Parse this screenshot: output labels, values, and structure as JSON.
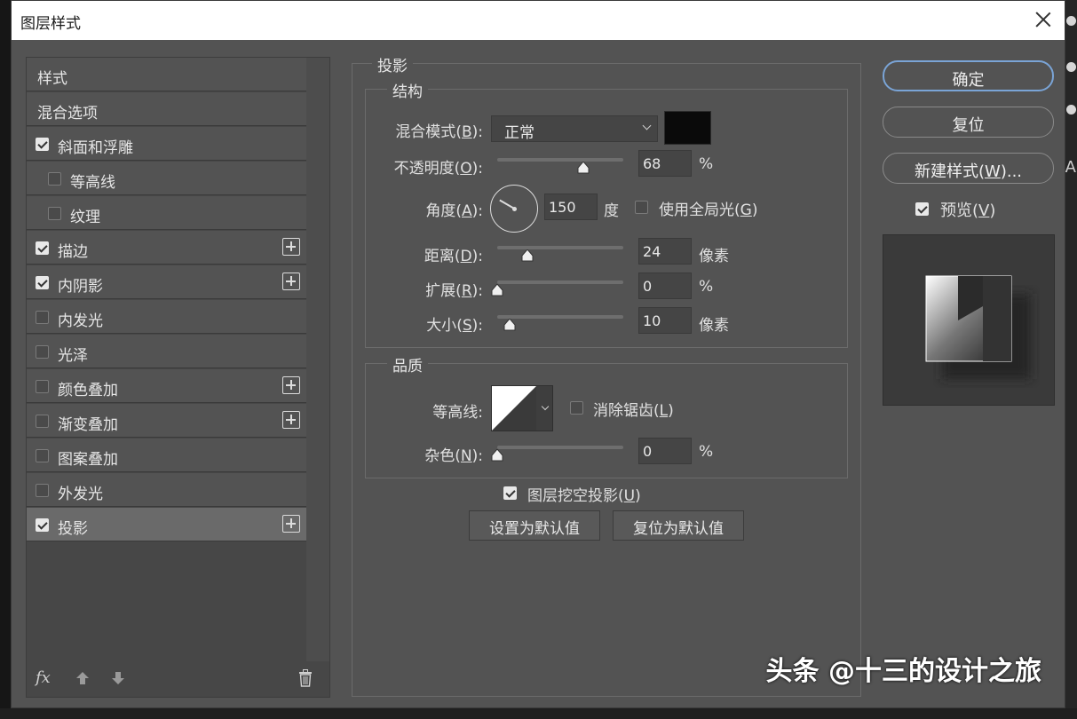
{
  "dialog": {
    "title": "图层样式"
  },
  "styles_list": {
    "items": [
      {
        "label": "样式",
        "checkbox": false,
        "checked": false,
        "plus": false,
        "indent": false,
        "selected": false
      },
      {
        "label": "混合选项",
        "checkbox": false,
        "checked": false,
        "plus": false,
        "indent": false,
        "selected": false
      },
      {
        "label": "斜面和浮雕",
        "checkbox": true,
        "checked": true,
        "plus": false,
        "indent": false,
        "selected": false
      },
      {
        "label": "等高线",
        "checkbox": true,
        "checked": false,
        "plus": false,
        "indent": true,
        "selected": false
      },
      {
        "label": "纹理",
        "checkbox": true,
        "checked": false,
        "plus": false,
        "indent": true,
        "selected": false
      },
      {
        "label": "描边",
        "checkbox": true,
        "checked": true,
        "plus": true,
        "indent": false,
        "selected": false
      },
      {
        "label": "内阴影",
        "checkbox": true,
        "checked": true,
        "plus": true,
        "indent": false,
        "selected": false
      },
      {
        "label": "内发光",
        "checkbox": true,
        "checked": false,
        "plus": false,
        "indent": false,
        "selected": false
      },
      {
        "label": "光泽",
        "checkbox": true,
        "checked": false,
        "plus": false,
        "indent": false,
        "selected": false
      },
      {
        "label": "颜色叠加",
        "checkbox": true,
        "checked": false,
        "plus": true,
        "indent": false,
        "selected": false
      },
      {
        "label": "渐变叠加",
        "checkbox": true,
        "checked": false,
        "plus": true,
        "indent": false,
        "selected": false
      },
      {
        "label": "图案叠加",
        "checkbox": true,
        "checked": false,
        "plus": false,
        "indent": false,
        "selected": false
      },
      {
        "label": "外发光",
        "checkbox": true,
        "checked": false,
        "plus": false,
        "indent": false,
        "selected": false
      },
      {
        "label": "投影",
        "checkbox": true,
        "checked": true,
        "plus": true,
        "indent": false,
        "selected": true
      }
    ],
    "footer_fx": "fx"
  },
  "drop_shadow": {
    "section_title": "投影",
    "structure": {
      "title": "结构",
      "blend_mode_label": "混合模式",
      "blend_mode_key": "B",
      "blend_mode_value": "正常",
      "shadow_color": "#0a0a0a",
      "opacity_label": "不透明度",
      "opacity_key": "O",
      "opacity_value": "68",
      "opacity_unit": "%",
      "opacity_fraction": 0.68,
      "angle_label": "角度",
      "angle_key": "A",
      "angle_value": "150",
      "angle_unit": "度",
      "global_light_label": "使用全局光",
      "global_light_key": "G",
      "global_light_checked": false,
      "distance_label": "距离",
      "distance_key": "D",
      "distance_value": "24",
      "distance_unit": "像素",
      "distance_fraction": 0.24,
      "spread_label": "扩展",
      "spread_key": "R",
      "spread_value": "0",
      "spread_unit": "%",
      "spread_fraction": 0,
      "size_label": "大小",
      "size_key": "S",
      "size_value": "10",
      "size_unit": "像素",
      "size_fraction": 0.1
    },
    "quality": {
      "title": "品质",
      "contour_label": "等高线",
      "anti_alias_label": "消除锯齿",
      "anti_alias_key": "L",
      "anti_alias_checked": false,
      "noise_label": "杂色",
      "noise_key": "N",
      "noise_value": "0",
      "noise_unit": "%",
      "noise_fraction": 0
    },
    "knockout_label": "图层挖空投影",
    "knockout_key": "U",
    "knockout_checked": true,
    "make_default_label": "设置为默认值",
    "reset_default_label": "复位为默认值"
  },
  "right_panel": {
    "ok_label": "确定",
    "reset_label": "复位",
    "new_style_label": "新建样式",
    "new_style_key": "W",
    "new_style_suffix": "...",
    "preview_label": "预览",
    "preview_key": "V",
    "preview_checked": true
  },
  "watermark": "头条 @十三的设计之旅",
  "colors": {
    "accent": "#7aa4d6",
    "panel": "#535353",
    "list": "#474747"
  }
}
